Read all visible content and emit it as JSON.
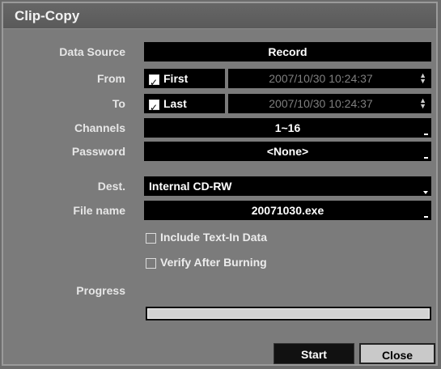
{
  "dialog": {
    "title": "Clip-Copy"
  },
  "fields": {
    "data_source": {
      "label": "Data Source",
      "value": "Record"
    },
    "from": {
      "label": "From",
      "checkbox_label": "First",
      "datetime": "2007/10/30  10:24:37",
      "checked": true
    },
    "to": {
      "label": "To",
      "checkbox_label": "Last",
      "datetime": "2007/10/30  10:24:37",
      "checked": true
    },
    "channels": {
      "label": "Channels",
      "value": "1~16"
    },
    "password": {
      "label": "Password",
      "value": "<None>"
    },
    "dest": {
      "label": "Dest.",
      "value": "Internal CD-RW"
    },
    "file_name": {
      "label": "File name",
      "value": "20071030.exe"
    }
  },
  "options": {
    "include_text_in": {
      "label": "Include Text-In Data",
      "checked": false
    },
    "verify_after_burning": {
      "label": "Verify After Burning",
      "checked": false
    }
  },
  "progress": {
    "label": "Progress",
    "fraction": 0
  },
  "buttons": {
    "start": "Start",
    "close": "Close"
  }
}
